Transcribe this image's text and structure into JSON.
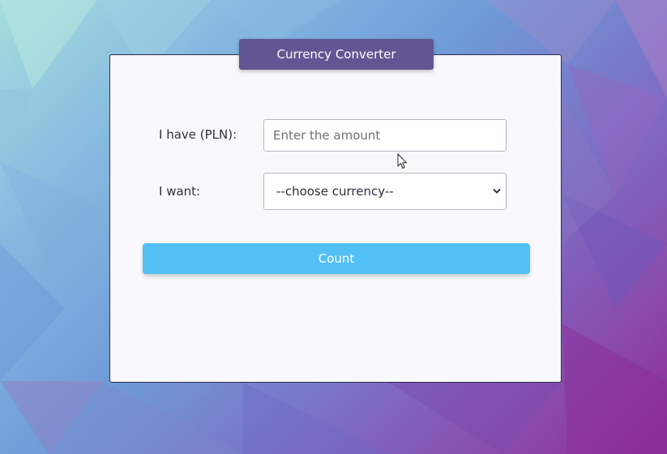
{
  "app": {
    "title": "Currency Converter"
  },
  "form": {
    "amount_label": "I have (PLN):",
    "amount_placeholder": "Enter the amount",
    "amount_value": "",
    "currency_label": "I want:",
    "currency_selected": "--choose currency--"
  },
  "actions": {
    "count_label": "Count"
  },
  "icons": {
    "select_arrow": "chevron-down-icon",
    "pointer": "mouse-cursor-icon"
  },
  "colors": {
    "title_tab": "#625593",
    "count_button": "#52c0f4",
    "card_background": "#f9f9fb"
  }
}
